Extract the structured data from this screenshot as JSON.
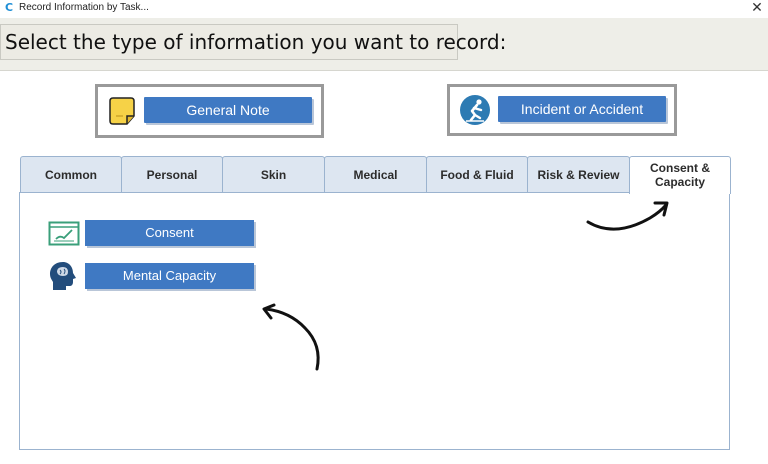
{
  "window": {
    "title": "Record  Information by Task...",
    "close_glyph": "✕"
  },
  "header": {
    "prompt": "Select the type of information you want to record:"
  },
  "quick_buttons": {
    "general_note": {
      "label": "General Note",
      "icon": "sticky-note-icon"
    },
    "incident": {
      "label": "Incident or Accident",
      "icon": "falling-person-icon"
    }
  },
  "tabs": [
    {
      "label": "Common"
    },
    {
      "label": "Personal"
    },
    {
      "label": "Skin"
    },
    {
      "label": "Medical"
    },
    {
      "label": "Food & Fluid"
    },
    {
      "label": "Risk & Review"
    },
    {
      "label": "Consent & Capacity",
      "line1": "Consent &",
      "line2": "Capacity",
      "active": true
    }
  ],
  "panel": {
    "items": [
      {
        "label": "Consent",
        "icon": "consent-form-icon"
      },
      {
        "label": "Mental Capacity",
        "icon": "head-brain-icon"
      }
    ]
  },
  "colors": {
    "accent": "#3f79c3",
    "tab_bg": "#dde6f1",
    "tab_border": "#9bb3cf",
    "header_bg": "#eeeee8"
  }
}
